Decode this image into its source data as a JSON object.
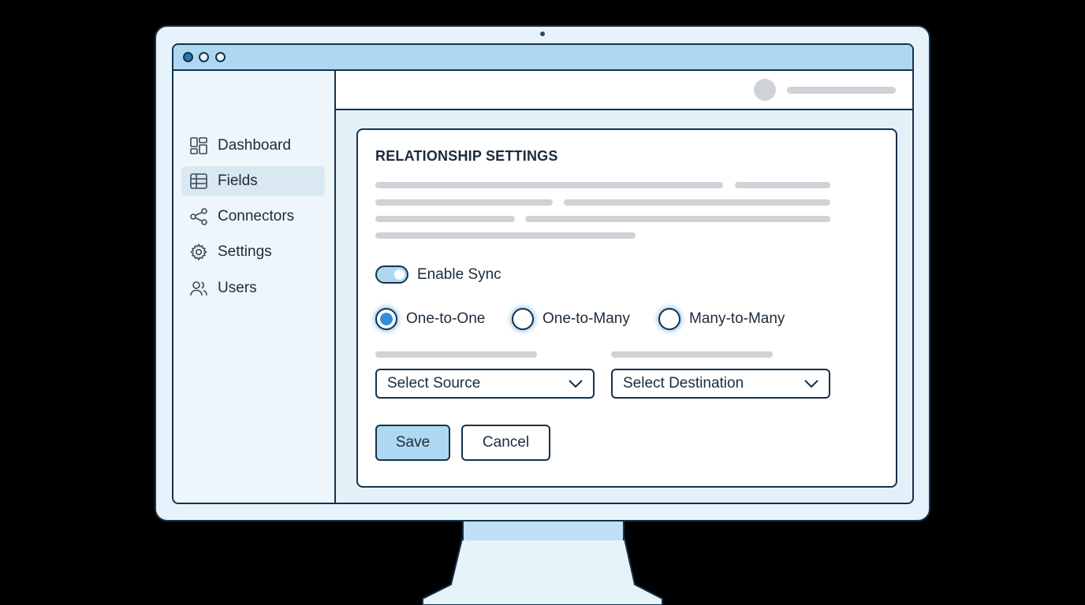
{
  "sidebar": {
    "items": [
      {
        "label": "Dashboard",
        "icon": "dashboard-icon",
        "active": false
      },
      {
        "label": "Fields",
        "icon": "table-icon",
        "active": true
      },
      {
        "label": "Connectors",
        "icon": "share-icon",
        "active": false
      },
      {
        "label": "Settings",
        "icon": "gear-icon",
        "active": false
      },
      {
        "label": "Users",
        "icon": "users-icon",
        "active": false
      }
    ]
  },
  "card": {
    "title": "RELATIONSHIP SETTINGS",
    "toggle": {
      "label": "Enable Sync",
      "on": true
    },
    "radios": [
      {
        "label": "One-to-One",
        "checked": true
      },
      {
        "label": "One-to-Many",
        "checked": false
      },
      {
        "label": "Many-to-Many",
        "checked": false
      }
    ],
    "source_select": {
      "value": "Select Source"
    },
    "destination_select": {
      "value": "Select Destination"
    },
    "save_label": "Save",
    "cancel_label": "Cancel"
  },
  "colors": {
    "accent": "#aed8f2",
    "radio_selected": "#2f8fe0",
    "outline": "#16324a",
    "placeholder": "#cfd3d7"
  }
}
